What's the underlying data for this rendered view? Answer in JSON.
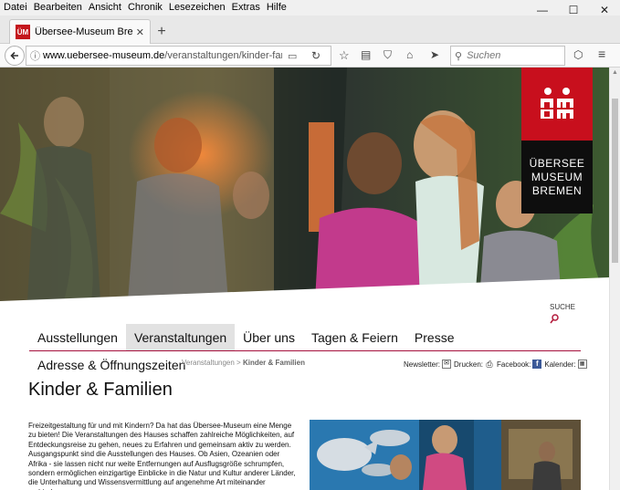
{
  "menubar": {
    "items": [
      "Datei",
      "Bearbeiten",
      "Ansicht",
      "Chronik",
      "Lesezeichen",
      "Extras",
      "Hilfe"
    ]
  },
  "window": {
    "minimize": "—",
    "maximize": "☐",
    "close": "✕"
  },
  "tab": {
    "favicon_text": "ÜM",
    "title": "Übersee-Museum Bremen...",
    "close": "✕",
    "new_tab": "+"
  },
  "navbar": {
    "url_domain": "www.uebersee-museum.de",
    "url_path": "/veranstaltungen/kinder-famili",
    "search_placeholder": "Suchen"
  },
  "logo": {
    "lines": [
      "ÜBERSEE",
      "MUSEUM",
      "BREMEN"
    ]
  },
  "site": {
    "search_label": "SUCHE",
    "nav": [
      "Ausstellungen",
      "Veranstaltungen",
      "Über uns",
      "Tagen & Feiern",
      "Presse"
    ],
    "active_nav": "Veranstaltungen",
    "nav_second": "Adresse & Öffnungszeiten",
    "breadcrumb_parent": "Veranstaltungen",
    "breadcrumb_sep": " > ",
    "breadcrumb_current": "Kinder & Familien",
    "social": {
      "newsletter": "Newsletter:",
      "print": "Drucken:",
      "facebook": "Facebook:",
      "calendar": "Kalender:"
    },
    "page_title": "Kinder & Familien",
    "body_text": "Freizeitgestaltung für und mit Kindern? Da hat das Übersee-Museum eine Menge zu bieten! Die Veranstaltungen des Hauses schaffen zahlreiche Möglichkeiten, auf Entdeckungsreise zu gehen, neues zu Erfahren und gemeinsam aktiv zu werden. Ausgangspunkt sind die Ausstellungen des Hauses. Ob Asien, Ozeanien oder Afrika - sie lassen nicht nur weite Entfernungen auf Ausflugsgröße schrumpfen, sondern ermöglichen einzigartige Einblicke in die Natur und Kultur anderer Länder, die Unterhaltung und Wissensvermittlung auf angenehme Art miteinander verbinden."
  },
  "colors": {
    "brand_red": "#c80f1d",
    "nav_border": "#a5103c",
    "active_nav_bg": "#e2e2e2"
  }
}
